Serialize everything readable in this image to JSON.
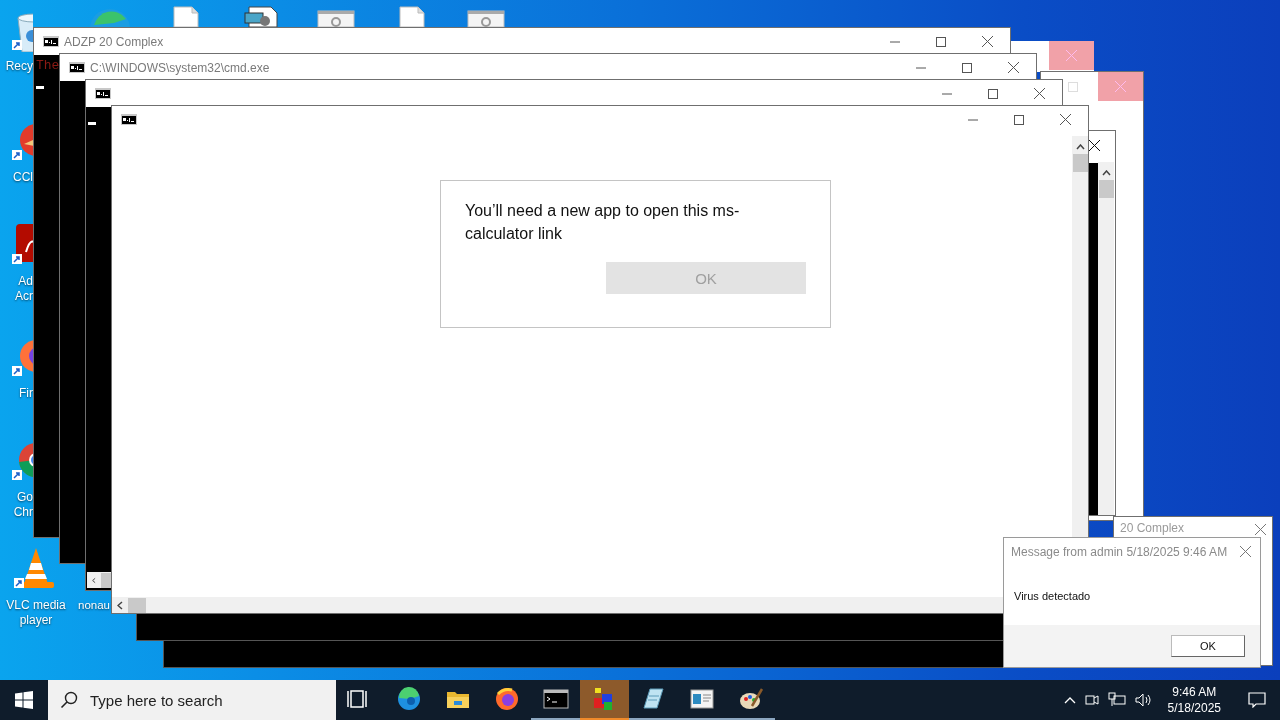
{
  "desktop_icons": [
    {
      "kind": "recycle-bin",
      "lines": [
        "Recy"
      ]
    },
    {
      "kind": "ccleaner",
      "lines": [
        "CCl"
      ]
    },
    {
      "kind": "acrobat",
      "lines": [
        "Ad",
        "Acr"
      ]
    },
    {
      "kind": "firefox",
      "lines": [
        "Fir"
      ]
    },
    {
      "kind": "chrome",
      "lines": [
        "Go",
        "Chr"
      ]
    },
    {
      "kind": "vlc",
      "lines": [
        "VLC media",
        "player"
      ]
    },
    {
      "kind": "hidden",
      "lines": [
        "nonau"
      ]
    }
  ],
  "top_icons": [
    {
      "kind": "edge"
    },
    {
      "kind": "file"
    },
    {
      "kind": "document"
    },
    {
      "kind": "settings"
    },
    {
      "kind": "file"
    },
    {
      "kind": "settings"
    }
  ],
  "windows": [
    {
      "kind": "stub",
      "close_highlighted": true
    },
    {
      "kind": "stub",
      "close_highlighted": true
    },
    {
      "kind": "narrow"
    },
    {
      "kind": "titled",
      "title": "20 Complex"
    },
    {
      "kind": "console",
      "title": "ADZP 20 Complex",
      "lines": [
        "The"
      ],
      "cursor": true
    },
    {
      "kind": "console",
      "title": "C:\\WINDOWS\\system32\\cmd.exe",
      "cursor": false
    },
    {
      "kind": "console",
      "cursor": true,
      "hscroll": true
    },
    {
      "kind": "console-tail"
    },
    {
      "kind": "console-tail"
    },
    {
      "kind": "front",
      "dialog": {
        "message": "You’ll need a new app to open this ms-calculator link",
        "button": {
          "label": "OK",
          "disabled": true
        }
      }
    }
  ],
  "message_box": {
    "title": "Message from admin 5/18/2025 9:46 AM",
    "body": "Virus detectado",
    "button": "OK"
  },
  "taskbar": {
    "search": {
      "placeholder": "Type here to search"
    },
    "items": [
      {
        "kind": "task-view",
        "running": false,
        "selected": false
      },
      {
        "kind": "edge",
        "running": false,
        "selected": false
      },
      {
        "kind": "explorer",
        "running": false,
        "selected": false
      },
      {
        "kind": "firefox",
        "running": false,
        "selected": false
      },
      {
        "kind": "cmd",
        "running": true,
        "selected": false
      },
      {
        "kind": "cubes",
        "running": true,
        "selected": true
      },
      {
        "kind": "notepad",
        "running": true,
        "selected": false
      },
      {
        "kind": "window",
        "running": true,
        "selected": false
      },
      {
        "kind": "paint",
        "running": true,
        "selected": false
      }
    ],
    "clock": {
      "time": "9:46 AM",
      "date": "5/18/2025"
    }
  }
}
